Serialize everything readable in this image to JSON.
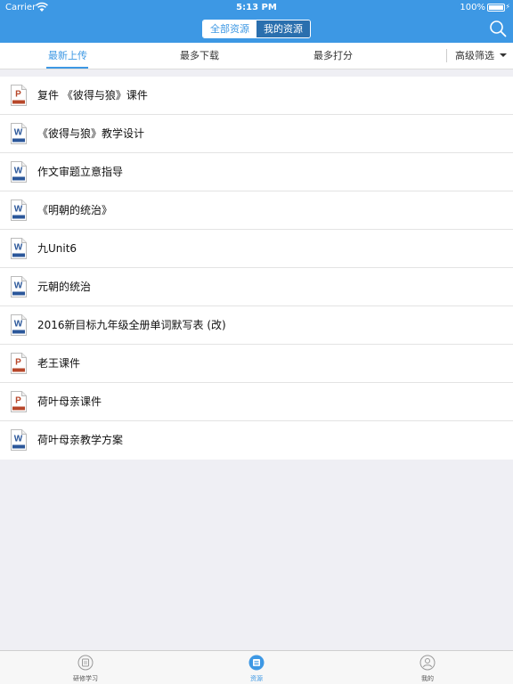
{
  "status_bar": {
    "carrier": "Carrier",
    "time": "5:13 PM",
    "battery_percent": "100%"
  },
  "nav": {
    "segments": [
      "全部资源",
      "我的资源"
    ],
    "selected_segment": "全部资源",
    "search_icon": "search-icon"
  },
  "filter": {
    "tabs": [
      "最新上传",
      "最多下载",
      "最多打分"
    ],
    "active_tab": "最新上传",
    "advanced_label": "高级筛选"
  },
  "resources": [
    {
      "title": "复件 《彼得与狼》课件",
      "type": "ppt",
      "badge": "P"
    },
    {
      "title": "《彼得与狼》教学设计",
      "type": "word",
      "badge": "W"
    },
    {
      "title": "作文审题立意指导",
      "type": "word",
      "badge": "W"
    },
    {
      "title": "《明朝的统治》",
      "type": "word",
      "badge": "W"
    },
    {
      "title": "九Unit6",
      "type": "word",
      "badge": "W"
    },
    {
      "title": "元朝的统治",
      "type": "word",
      "badge": "W"
    },
    {
      "title": "2016新目标九年级全册单词默写表 (改)",
      "type": "word",
      "badge": "W"
    },
    {
      "title": "老王课件",
      "type": "ppt",
      "badge": "P"
    },
    {
      "title": "荷叶母亲课件",
      "type": "ppt",
      "badge": "P"
    },
    {
      "title": "荷叶母亲教学方案",
      "type": "word",
      "badge": "W"
    }
  ],
  "tab_bar": {
    "items": [
      {
        "label": "研修学习",
        "icon": "study-icon"
      },
      {
        "label": "资源",
        "icon": "resources-icon"
      },
      {
        "label": "我的",
        "icon": "profile-icon"
      }
    ],
    "active": "资源"
  },
  "colors": {
    "primary": "#3d98e4",
    "word_blue": "#2b579a",
    "ppt_red": "#b7472a"
  }
}
